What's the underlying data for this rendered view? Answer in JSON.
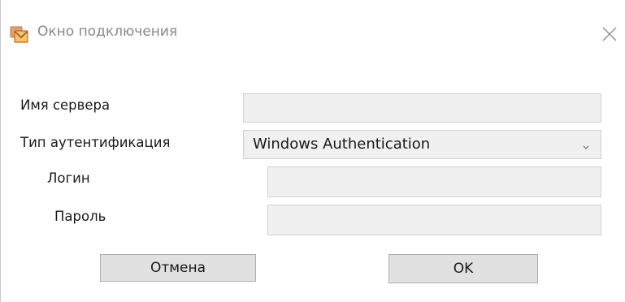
{
  "window": {
    "title": "Окно подключения",
    "icons": {
      "app": "envelope-folder-icon",
      "close": "close-icon"
    }
  },
  "form": {
    "server_label": "Имя сервера",
    "server_value": "",
    "auth_label": "Тип аутентификация",
    "auth_selected": "Windows Authentication",
    "login_label": "Логин",
    "login_value": "",
    "password_label": "Пароль",
    "password_value": ""
  },
  "buttons": {
    "cancel": "Отмена",
    "ok": "OK"
  }
}
